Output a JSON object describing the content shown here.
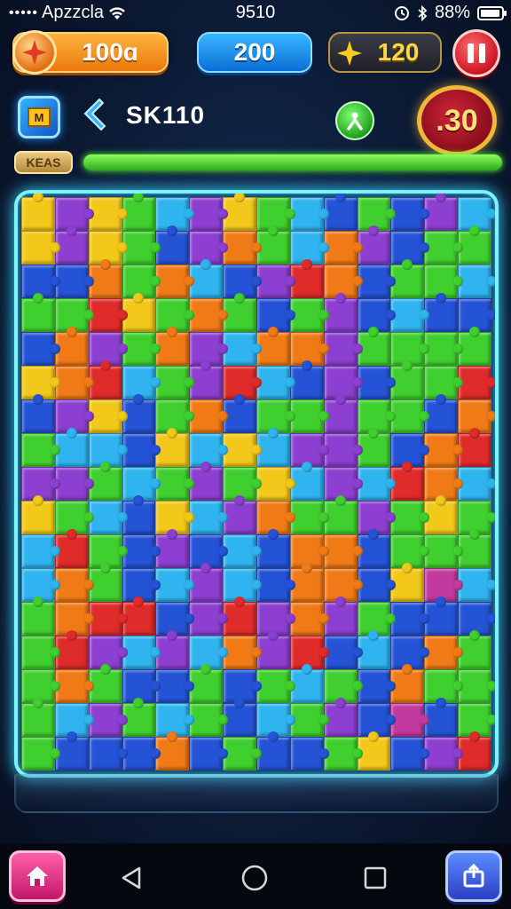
{
  "status_bar": {
    "carrier": "Apzzcla",
    "signal_dots": "•••••",
    "time": "9510",
    "battery": "88%"
  },
  "hud": {
    "coins": "100ɑ",
    "score": "200",
    "gems": "120"
  },
  "level": {
    "badge_text": "M",
    "player_name": "SK110",
    "timer": ".30"
  },
  "progress": {
    "label": "KEAS",
    "fraction": 1.0
  },
  "board": {
    "rows": 17,
    "cols": 14,
    "colors": {
      "yellow": "#f2c81a",
      "purple": "#8c3fd0",
      "green": "#3fcf2e",
      "blue": "#2553d6",
      "cyan": "#2fb4ef",
      "orange": "#f07a16",
      "red": "#e02b2b",
      "magenta": "#c23a9e"
    },
    "pieces": [
      "yellow",
      "purple",
      "yellow",
      "green",
      "cyan",
      "purple",
      "yellow",
      "green",
      "cyan",
      "blue",
      "green",
      "blue",
      "purple",
      "cyan",
      "yellow",
      "purple",
      "yellow",
      "green",
      "blue",
      "purple",
      "orange",
      "green",
      "cyan",
      "orange",
      "purple",
      "blue",
      "green",
      "green",
      "blue",
      "blue",
      "orange",
      "green",
      "orange",
      "cyan",
      "blue",
      "purple",
      "red",
      "orange",
      "blue",
      "green",
      "green",
      "cyan",
      "green",
      "green",
      "red",
      "yellow",
      "green",
      "orange",
      "green",
      "blue",
      "green",
      "purple",
      "blue",
      "cyan",
      "blue",
      "blue",
      "blue",
      "orange",
      "purple",
      "green",
      "orange",
      "purple",
      "cyan",
      "orange",
      "orange",
      "purple",
      "green",
      "green",
      "green",
      "green",
      "yellow",
      "orange",
      "red",
      "cyan",
      "green",
      "purple",
      "red",
      "cyan",
      "blue",
      "purple",
      "blue",
      "green",
      "green",
      "red",
      "blue",
      "purple",
      "yellow",
      "blue",
      "green",
      "orange",
      "blue",
      "green",
      "green",
      "purple",
      "green",
      "green",
      "blue",
      "orange",
      "green",
      "cyan",
      "cyan",
      "blue",
      "yellow",
      "cyan",
      "yellow",
      "cyan",
      "purple",
      "purple",
      "green",
      "blue",
      "orange",
      "red",
      "purple",
      "purple",
      "green",
      "cyan",
      "green",
      "purple",
      "green",
      "yellow",
      "cyan",
      "purple",
      "cyan",
      "red",
      "orange",
      "cyan",
      "yellow",
      "green",
      "cyan",
      "blue",
      "yellow",
      "cyan",
      "purple",
      "orange",
      "green",
      "green",
      "purple",
      "green",
      "yellow",
      "green",
      "cyan",
      "red",
      "green",
      "blue",
      "purple",
      "blue",
      "cyan",
      "blue",
      "orange",
      "orange",
      "blue",
      "green",
      "green",
      "green",
      "cyan",
      "orange",
      "green",
      "blue",
      "cyan",
      "purple",
      "cyan",
      "blue",
      "orange",
      "orange",
      "blue",
      "yellow",
      "magenta",
      "cyan",
      "green",
      "orange",
      "red",
      "red",
      "blue",
      "purple",
      "red",
      "purple",
      "orange",
      "purple",
      "green",
      "blue",
      "blue",
      "blue",
      "green",
      "red",
      "purple",
      "cyan",
      "purple",
      "cyan",
      "orange",
      "purple",
      "red",
      "blue",
      "cyan",
      "blue",
      "orange",
      "green",
      "green",
      "orange",
      "green",
      "blue",
      "blue",
      "green",
      "blue",
      "green",
      "cyan",
      "green",
      "blue",
      "orange",
      "green",
      "green",
      "green",
      "cyan",
      "purple",
      "green",
      "cyan",
      "green",
      "blue",
      "cyan",
      "green",
      "purple",
      "blue",
      "magenta",
      "blue",
      "green",
      "green",
      "blue",
      "blue",
      "blue",
      "orange",
      "blue",
      "green",
      "blue",
      "blue",
      "green",
      "yellow",
      "blue",
      "purple",
      "red"
    ]
  },
  "nav": {
    "home_label": "⌂",
    "back": "◁",
    "home_sys": "○",
    "recents": "□"
  }
}
